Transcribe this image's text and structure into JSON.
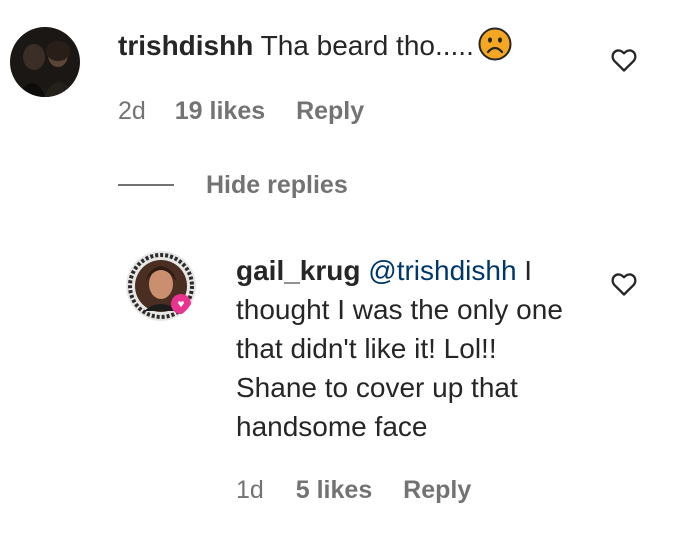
{
  "comment": {
    "username": "trishdishh",
    "text": "Tha beard tho.....",
    "emoji": "frowning-face",
    "time": "2d",
    "likes": "19 likes",
    "reply_label": "Reply"
  },
  "thread": {
    "hide_replies_label": "Hide replies"
  },
  "reply": {
    "username": "gail_krug",
    "mention": "@trishdishh",
    "text": " I thought I was the only one that didn't like it! Lol!! Shane to cover up that handsome face",
    "time": "1d",
    "likes": "5 likes",
    "reply_label": "Reply"
  },
  "colors": {
    "text": "#262626",
    "secondary": "#737373",
    "mention": "#00376b",
    "emoji_face": "#f5a623"
  },
  "icons": [
    "heart-outline-icon",
    "frowning-face-emoji"
  ]
}
